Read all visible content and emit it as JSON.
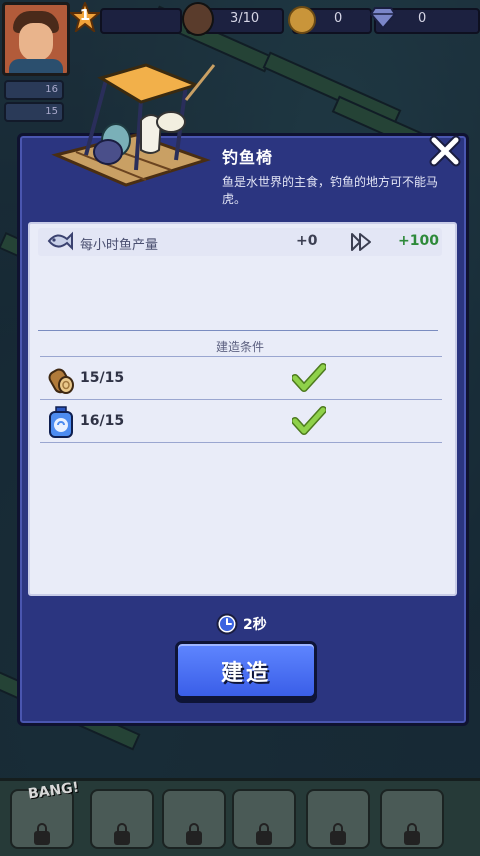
{
  "hud": {
    "level": "1",
    "population": "3/10",
    "coins": "0",
    "gems": "0",
    "side_stat_1": "16",
    "side_stat_2": "15"
  },
  "modal": {
    "title": "钓鱼椅",
    "description": "鱼是水世界的主食，钓鱼的地方可不能马虎。",
    "production": {
      "label": "每小时鱼产量",
      "current": "+0",
      "next": "+100"
    },
    "conditions_title": "建造条件",
    "conditions": [
      {
        "icon": "log-icon",
        "value": "15/15",
        "met": true
      },
      {
        "icon": "water-bottle-icon",
        "value": "16/15",
        "met": true
      }
    ],
    "build_time": "2秒",
    "build_button": "建造"
  },
  "bottom_bar": {
    "bang_label": "BANG!",
    "slots": [
      "raft-icon",
      "survivor-icon",
      "crate-icon",
      "fist-icon",
      "gift-icon",
      "map-icon"
    ]
  },
  "colors": {
    "modal_bg": "#2b3580",
    "panel_bg": "#e9ecf8",
    "positive_green": "#2e8a3a",
    "button_blue": "#4a6ef5"
  }
}
